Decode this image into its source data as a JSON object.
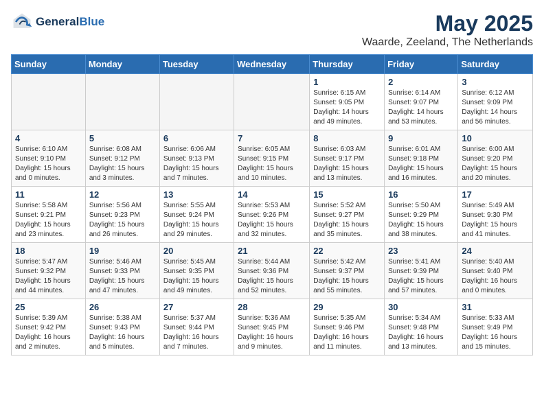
{
  "header": {
    "logo_line1": "General",
    "logo_line2": "Blue",
    "month_title": "May 2025",
    "location": "Waarde, Zeeland, The Netherlands"
  },
  "weekdays": [
    "Sunday",
    "Monday",
    "Tuesday",
    "Wednesday",
    "Thursday",
    "Friday",
    "Saturday"
  ],
  "weeks": [
    [
      {
        "day": "",
        "info": ""
      },
      {
        "day": "",
        "info": ""
      },
      {
        "day": "",
        "info": ""
      },
      {
        "day": "",
        "info": ""
      },
      {
        "day": "1",
        "info": "Sunrise: 6:15 AM\nSunset: 9:05 PM\nDaylight: 14 hours\nand 49 minutes."
      },
      {
        "day": "2",
        "info": "Sunrise: 6:14 AM\nSunset: 9:07 PM\nDaylight: 14 hours\nand 53 minutes."
      },
      {
        "day": "3",
        "info": "Sunrise: 6:12 AM\nSunset: 9:09 PM\nDaylight: 14 hours\nand 56 minutes."
      }
    ],
    [
      {
        "day": "4",
        "info": "Sunrise: 6:10 AM\nSunset: 9:10 PM\nDaylight: 15 hours\nand 0 minutes."
      },
      {
        "day": "5",
        "info": "Sunrise: 6:08 AM\nSunset: 9:12 PM\nDaylight: 15 hours\nand 3 minutes."
      },
      {
        "day": "6",
        "info": "Sunrise: 6:06 AM\nSunset: 9:13 PM\nDaylight: 15 hours\nand 7 minutes."
      },
      {
        "day": "7",
        "info": "Sunrise: 6:05 AM\nSunset: 9:15 PM\nDaylight: 15 hours\nand 10 minutes."
      },
      {
        "day": "8",
        "info": "Sunrise: 6:03 AM\nSunset: 9:17 PM\nDaylight: 15 hours\nand 13 minutes."
      },
      {
        "day": "9",
        "info": "Sunrise: 6:01 AM\nSunset: 9:18 PM\nDaylight: 15 hours\nand 16 minutes."
      },
      {
        "day": "10",
        "info": "Sunrise: 6:00 AM\nSunset: 9:20 PM\nDaylight: 15 hours\nand 20 minutes."
      }
    ],
    [
      {
        "day": "11",
        "info": "Sunrise: 5:58 AM\nSunset: 9:21 PM\nDaylight: 15 hours\nand 23 minutes."
      },
      {
        "day": "12",
        "info": "Sunrise: 5:56 AM\nSunset: 9:23 PM\nDaylight: 15 hours\nand 26 minutes."
      },
      {
        "day": "13",
        "info": "Sunrise: 5:55 AM\nSunset: 9:24 PM\nDaylight: 15 hours\nand 29 minutes."
      },
      {
        "day": "14",
        "info": "Sunrise: 5:53 AM\nSunset: 9:26 PM\nDaylight: 15 hours\nand 32 minutes."
      },
      {
        "day": "15",
        "info": "Sunrise: 5:52 AM\nSunset: 9:27 PM\nDaylight: 15 hours\nand 35 minutes."
      },
      {
        "day": "16",
        "info": "Sunrise: 5:50 AM\nSunset: 9:29 PM\nDaylight: 15 hours\nand 38 minutes."
      },
      {
        "day": "17",
        "info": "Sunrise: 5:49 AM\nSunset: 9:30 PM\nDaylight: 15 hours\nand 41 minutes."
      }
    ],
    [
      {
        "day": "18",
        "info": "Sunrise: 5:47 AM\nSunset: 9:32 PM\nDaylight: 15 hours\nand 44 minutes."
      },
      {
        "day": "19",
        "info": "Sunrise: 5:46 AM\nSunset: 9:33 PM\nDaylight: 15 hours\nand 47 minutes."
      },
      {
        "day": "20",
        "info": "Sunrise: 5:45 AM\nSunset: 9:35 PM\nDaylight: 15 hours\nand 49 minutes."
      },
      {
        "day": "21",
        "info": "Sunrise: 5:44 AM\nSunset: 9:36 PM\nDaylight: 15 hours\nand 52 minutes."
      },
      {
        "day": "22",
        "info": "Sunrise: 5:42 AM\nSunset: 9:37 PM\nDaylight: 15 hours\nand 55 minutes."
      },
      {
        "day": "23",
        "info": "Sunrise: 5:41 AM\nSunset: 9:39 PM\nDaylight: 15 hours\nand 57 minutes."
      },
      {
        "day": "24",
        "info": "Sunrise: 5:40 AM\nSunset: 9:40 PM\nDaylight: 16 hours\nand 0 minutes."
      }
    ],
    [
      {
        "day": "25",
        "info": "Sunrise: 5:39 AM\nSunset: 9:42 PM\nDaylight: 16 hours\nand 2 minutes."
      },
      {
        "day": "26",
        "info": "Sunrise: 5:38 AM\nSunset: 9:43 PM\nDaylight: 16 hours\nand 5 minutes."
      },
      {
        "day": "27",
        "info": "Sunrise: 5:37 AM\nSunset: 9:44 PM\nDaylight: 16 hours\nand 7 minutes."
      },
      {
        "day": "28",
        "info": "Sunrise: 5:36 AM\nSunset: 9:45 PM\nDaylight: 16 hours\nand 9 minutes."
      },
      {
        "day": "29",
        "info": "Sunrise: 5:35 AM\nSunset: 9:46 PM\nDaylight: 16 hours\nand 11 minutes."
      },
      {
        "day": "30",
        "info": "Sunrise: 5:34 AM\nSunset: 9:48 PM\nDaylight: 16 hours\nand 13 minutes."
      },
      {
        "day": "31",
        "info": "Sunrise: 5:33 AM\nSunset: 9:49 PM\nDaylight: 16 hours\nand 15 minutes."
      }
    ]
  ]
}
